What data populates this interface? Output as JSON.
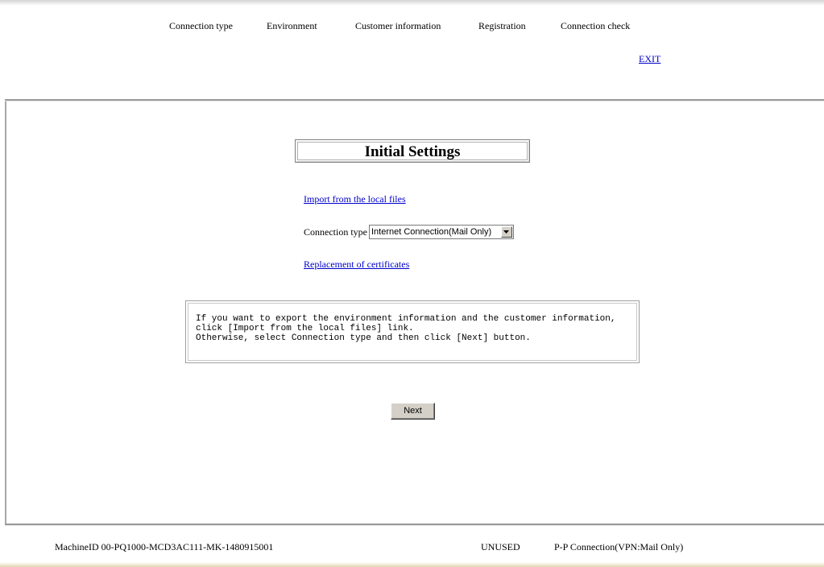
{
  "steps": [
    {
      "label": "Connection type"
    },
    {
      "label": "Environment"
    },
    {
      "label": "Customer information"
    },
    {
      "label": "Registration"
    },
    {
      "label": "Connection check"
    }
  ],
  "header": {
    "exit_label": "EXIT"
  },
  "main": {
    "title": "Initial Settings",
    "import_link": "Import from the local files",
    "connection_type_label": "Connection type",
    "connection_type_value": "Internet Connection(Mail Only)",
    "replace_link": "Replacement of certificates",
    "message_lines": [
      "If you want to export the environment information and the customer information,",
      "click [Import from the local files] link.",
      "Otherwise, select Connection type and then click [Next] button."
    ],
    "next_label": "Next"
  },
  "footer": {
    "machine_id": "MachineID  00-PQ1000-MCD3AC111-MK-1480915001",
    "status": "UNUSED",
    "connection_mode": "P-P Connection(VPN:Mail Only)"
  },
  "colors": {
    "link": "#0000cc",
    "button_face": "#d4d0c8",
    "divider": "#9a9a9a"
  }
}
